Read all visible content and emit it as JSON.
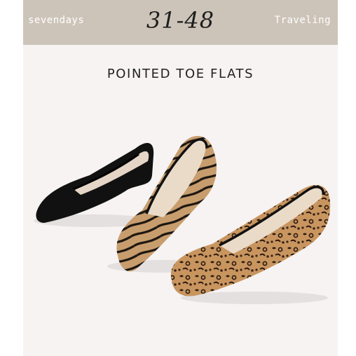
{
  "header": {
    "brand": "sevendays",
    "size_range": "31-48",
    "tagline": "Traveling",
    "background_color": "#cdc4b9"
  },
  "product": {
    "title": "POINTED TOE FLATS",
    "variants": [
      {
        "name": "black-knit",
        "color": "#111111"
      },
      {
        "name": "zebra",
        "color": "#c69a6a"
      },
      {
        "name": "leopard",
        "color": "#c8935c"
      }
    ]
  }
}
